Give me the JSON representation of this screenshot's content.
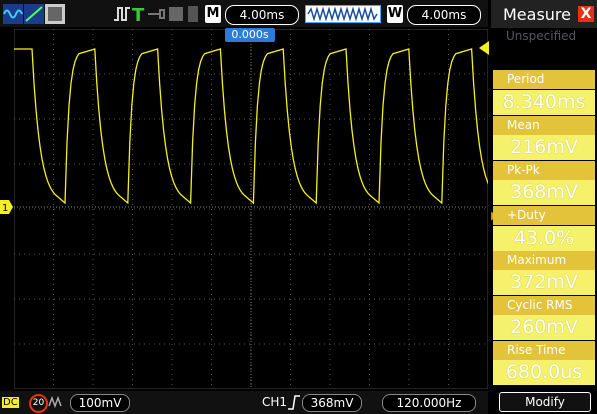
{
  "topbar": {
    "m_label": "M",
    "m_timebase": "4.00ms",
    "w_label": "W",
    "w_timebase": "4.00ms",
    "trigger_time": "0.000s"
  },
  "measure_panel": {
    "title": "Measure",
    "close_label": "X",
    "source": "Unspecified",
    "items": [
      {
        "label": "Period",
        "value": "8.340ms"
      },
      {
        "label": "Mean",
        "value": "216mV"
      },
      {
        "label": "Pk-Pk",
        "value": "368mV"
      },
      {
        "label": "+Duty",
        "value": "43.0%"
      },
      {
        "label": "Maximum",
        "value": "372mV"
      },
      {
        "label": "Cyclic RMS",
        "value": "260mV"
      },
      {
        "label": "Rise Time",
        "value": "680.0us"
      }
    ],
    "modify_label": "Modify"
  },
  "bottombar": {
    "coupling": "DC",
    "bw_limit": "20",
    "volts_div": "100mV",
    "trigger_channel": "CH1",
    "trigger_level": "368mV",
    "frequency": "120.000Hz"
  },
  "channel_marker": "1",
  "colors": {
    "trace": "#f5ef20",
    "label_bar": "#e3c33a",
    "value_bar": "#f5f16a",
    "close": "#e63018",
    "trigger_box": "#2d7bd6"
  }
}
